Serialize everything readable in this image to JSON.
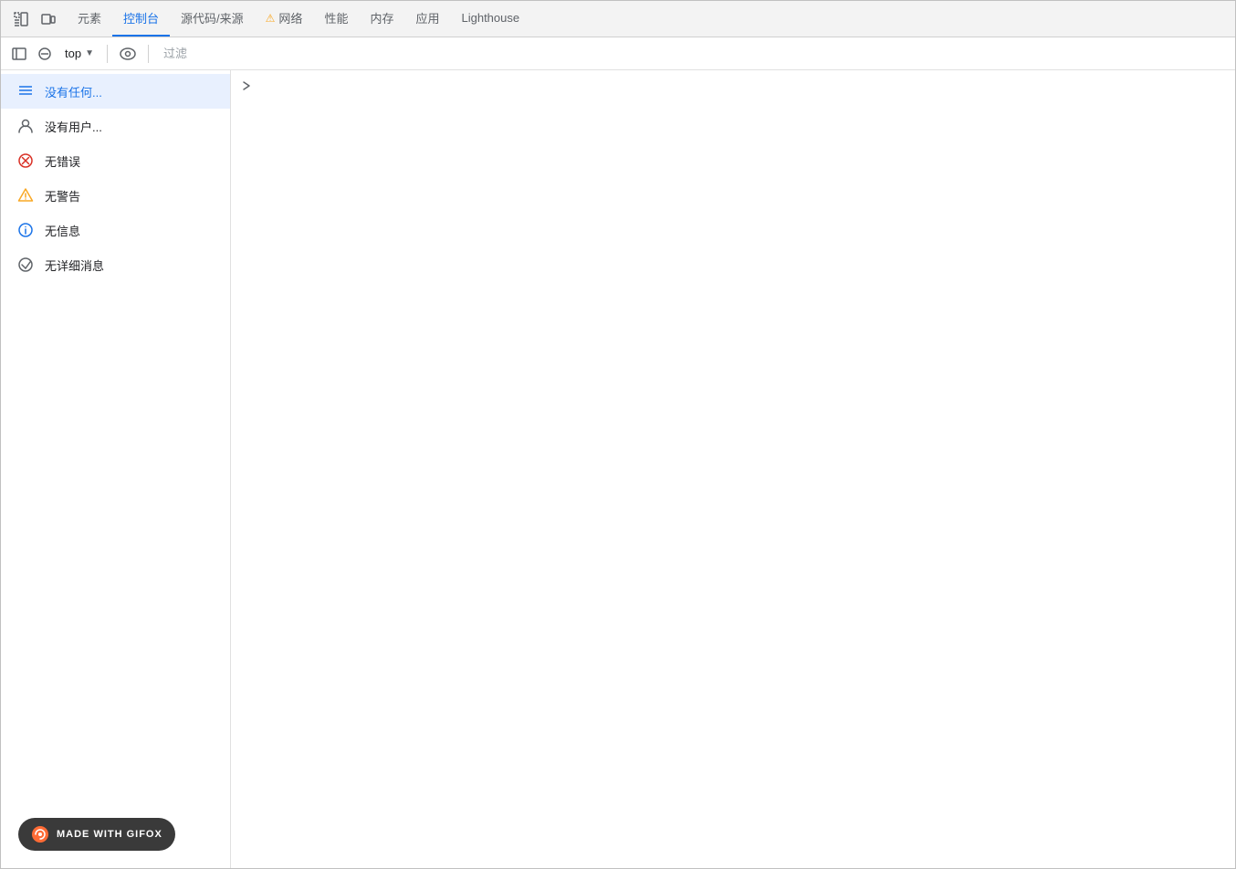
{
  "toolbar": {
    "tabs": [
      {
        "id": "elements",
        "label": "元素",
        "active": false,
        "warning": false
      },
      {
        "id": "console",
        "label": "控制台",
        "active": true,
        "warning": false
      },
      {
        "id": "sources",
        "label": "源代码/来源",
        "active": false,
        "warning": false
      },
      {
        "id": "network",
        "label": "网络",
        "active": false,
        "warning": true
      },
      {
        "id": "performance",
        "label": "性能",
        "active": false,
        "warning": false
      },
      {
        "id": "memory",
        "label": "内存",
        "active": false,
        "warning": false
      },
      {
        "id": "application",
        "label": "应用",
        "active": false,
        "warning": false
      },
      {
        "id": "lighthouse",
        "label": "Lighthouse",
        "active": false,
        "warning": false
      }
    ]
  },
  "secondToolbar": {
    "dropdown_label": "top",
    "filter_placeholder": "过滤"
  },
  "filterPanel": {
    "items": [
      {
        "id": "all",
        "label": "没有任何...",
        "icon": "list",
        "active": true
      },
      {
        "id": "user",
        "label": "没有用户...",
        "icon": "user",
        "active": false
      },
      {
        "id": "errors",
        "label": "无错误",
        "icon": "error",
        "active": false
      },
      {
        "id": "warnings",
        "label": "无警告",
        "icon": "warning",
        "active": false
      },
      {
        "id": "info",
        "label": "无信息",
        "icon": "info",
        "active": false
      },
      {
        "id": "verbose",
        "label": "无详细消息",
        "icon": "verbose",
        "active": false
      }
    ]
  },
  "gifox": {
    "label": "MADE WITH GIFOX"
  }
}
